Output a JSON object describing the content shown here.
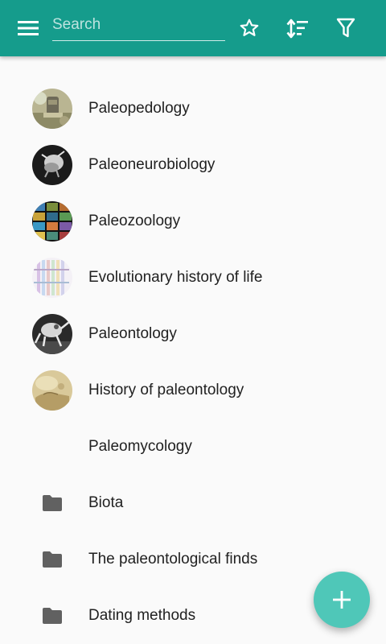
{
  "toolbar": {
    "search_placeholder": "Search",
    "search_value": "",
    "icons": [
      "menu-icon",
      "star-outline-icon",
      "sort-icon",
      "filter-icon"
    ]
  },
  "items": [
    {
      "label": "Paleopedology",
      "kind": "article",
      "thumb": "stone-artifact"
    },
    {
      "label": "Paleoneurobiology",
      "kind": "article",
      "thumb": "skull-dark"
    },
    {
      "label": "Paleozoology",
      "kind": "article",
      "thumb": "collage-grid"
    },
    {
      "label": "Evolutionary history of life",
      "kind": "article",
      "thumb": "timeline-chart"
    },
    {
      "label": "Paleontology",
      "kind": "article",
      "thumb": "fossil-skeleton"
    },
    {
      "label": "History of paleontology",
      "kind": "article",
      "thumb": "old-engraving"
    },
    {
      "label": "Paleomycology",
      "kind": "article",
      "thumb": "none"
    },
    {
      "label": "Biota",
      "kind": "folder"
    },
    {
      "label": "The paleontological finds",
      "kind": "folder"
    },
    {
      "label": "Dating methods",
      "kind": "folder"
    }
  ],
  "fab": {
    "icon": "plus-icon"
  },
  "colors": {
    "appbar": "#159c8c",
    "fab": "#4fc7b8",
    "folder": "#616161",
    "text": "#212121",
    "background": "#fafafa"
  }
}
